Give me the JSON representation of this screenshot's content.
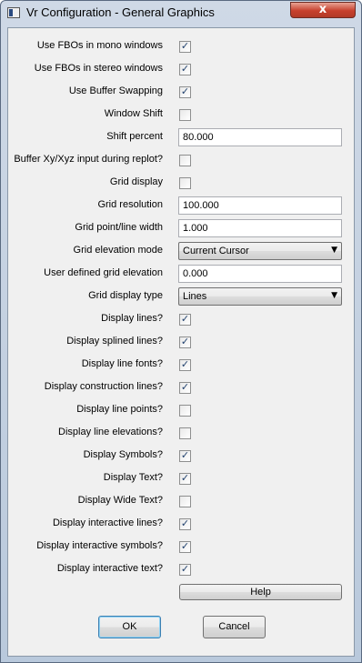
{
  "window": {
    "title": "Vr Configuration - General Graphics",
    "close_glyph": "x",
    "app_icon": "window-icon"
  },
  "settings": [
    {
      "label": "Use FBOs in mono windows",
      "type": "checkbox",
      "checked": true
    },
    {
      "label": "Use FBOs in stereo windows",
      "type": "checkbox",
      "checked": true
    },
    {
      "label": "Use Buffer Swapping",
      "type": "checkbox",
      "checked": true
    },
    {
      "label": "Window Shift",
      "type": "checkbox",
      "checked": false
    },
    {
      "label": "Shift percent",
      "type": "text",
      "value": "80.000"
    },
    {
      "label": "Buffer Xy/Xyz input during replot?",
      "type": "checkbox",
      "checked": false
    },
    {
      "label": "Grid display",
      "type": "checkbox",
      "checked": false
    },
    {
      "label": "Grid resolution",
      "type": "text",
      "value": "100.000"
    },
    {
      "label": "Grid point/line width",
      "type": "text",
      "value": "1.000"
    },
    {
      "label": "Grid elevation mode",
      "type": "select",
      "value": "Current Cursor"
    },
    {
      "label": "User defined grid elevation",
      "type": "text",
      "value": "0.000"
    },
    {
      "label": "Grid display type",
      "type": "select",
      "value": "Lines"
    },
    {
      "label": "Display lines?",
      "type": "checkbox",
      "checked": true
    },
    {
      "label": "Display splined lines?",
      "type": "checkbox",
      "checked": true
    },
    {
      "label": "Display line fonts?",
      "type": "checkbox",
      "checked": true
    },
    {
      "label": "Display construction lines?",
      "type": "checkbox",
      "checked": true
    },
    {
      "label": "Display line points?",
      "type": "checkbox",
      "checked": false
    },
    {
      "label": "Display line elevations?",
      "type": "checkbox",
      "checked": false
    },
    {
      "label": "Display Symbols?",
      "type": "checkbox",
      "checked": true
    },
    {
      "label": "Display Text?",
      "type": "checkbox",
      "checked": true
    },
    {
      "label": "Display Wide Text?",
      "type": "checkbox",
      "checked": false
    },
    {
      "label": "Display interactive lines?",
      "type": "checkbox",
      "checked": true
    },
    {
      "label": "Display interactive symbols?",
      "type": "checkbox",
      "checked": true
    },
    {
      "label": "Display interactive text?",
      "type": "checkbox",
      "checked": true
    }
  ],
  "buttons": {
    "help": "Help",
    "ok": "OK",
    "cancel": "Cancel"
  },
  "colors": {
    "check": "#23436f",
    "close": "#c7402d"
  }
}
